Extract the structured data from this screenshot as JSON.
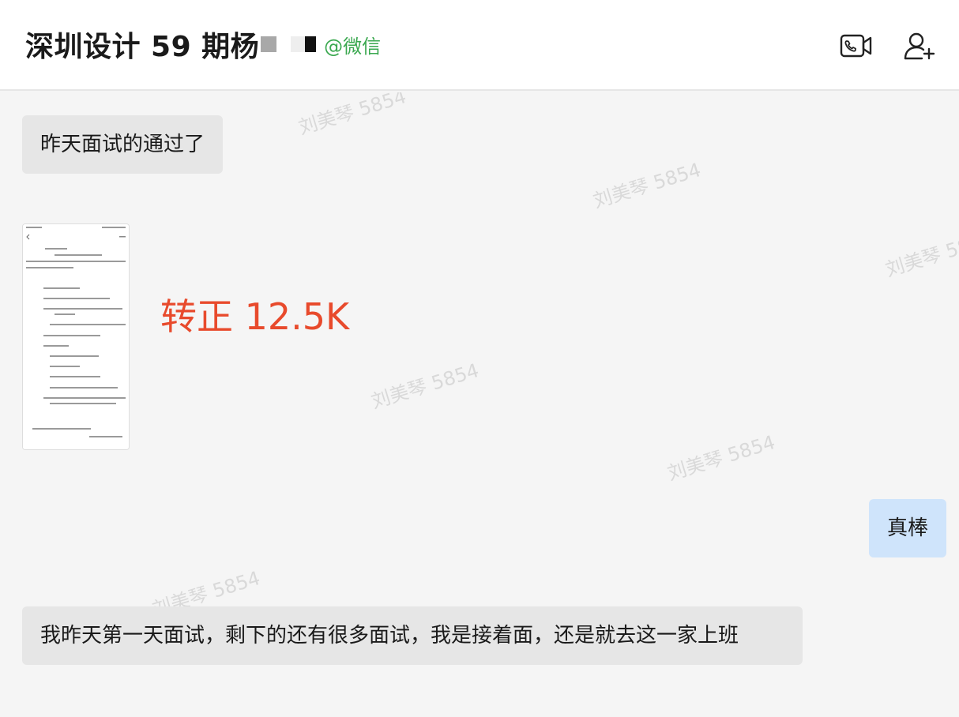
{
  "header": {
    "title": "深圳设计 59 期杨",
    "wechat_tag": "@微信"
  },
  "messages": [
    {
      "side": "left",
      "text": "昨天面试的通过了"
    },
    {
      "side": "left",
      "type": "image",
      "overlay_text": "转正 12.5K"
    },
    {
      "side": "right",
      "text": "真棒"
    },
    {
      "side": "left",
      "text": "我昨天第一天面试，剩下的还有很多面试，我是接着面，还是就去这一家上班"
    }
  ],
  "watermark": "刘美琴 5854",
  "colors": {
    "accent_green": "#3aa84f",
    "overlay_red": "#e84a2c",
    "bubble_left": "#e6e6e6",
    "bubble_right": "#cfe4fb"
  },
  "icons": {
    "call": "video-call-icon",
    "add": "add-user-icon"
  }
}
